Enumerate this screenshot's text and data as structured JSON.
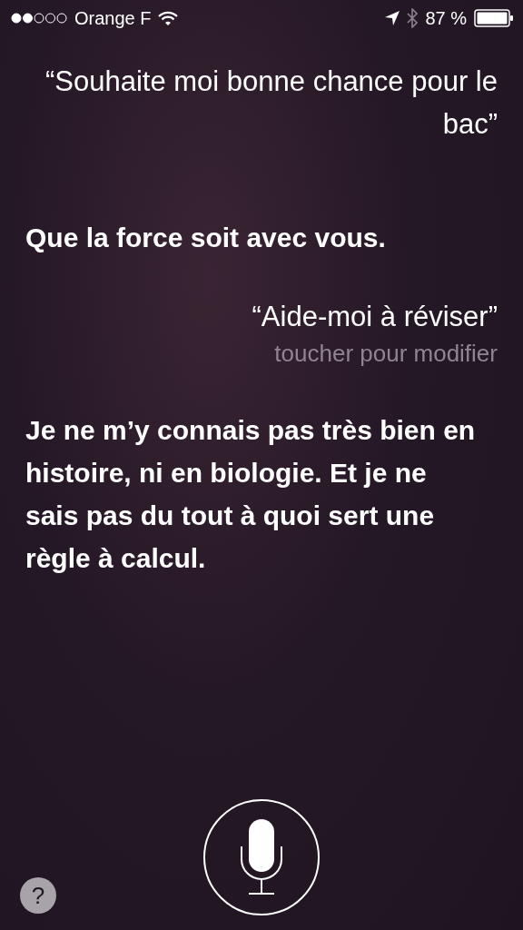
{
  "status_bar": {
    "carrier": "Orange F",
    "battery_percent": "87 %"
  },
  "conversation": [
    {
      "kind": "user",
      "text": "“Souhaite moi bonne chance pour le bac”"
    },
    {
      "kind": "siri",
      "text": "Que la force soit avec vous."
    },
    {
      "kind": "user",
      "text": "“Aide-moi à réviser”",
      "hint": "toucher pour modifier"
    },
    {
      "kind": "siri",
      "text": "Je ne m’y connais pas très bien en histoire, ni en biologie. Et je ne sais pas du tout à quoi sert une règle à calcul."
    }
  ],
  "help_button": {
    "label": "?"
  }
}
